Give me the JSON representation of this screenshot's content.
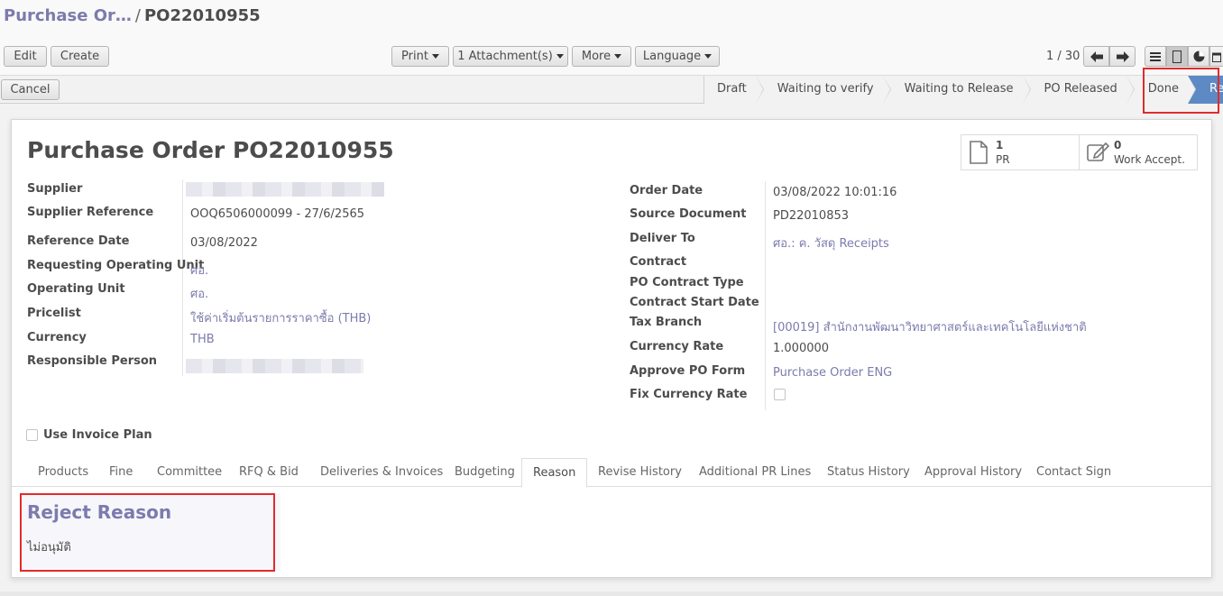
{
  "breadcrumb": {
    "parent": "Purchase Or…",
    "separator": "/",
    "current": "PO22010955"
  },
  "toolbar": {
    "edit_label": "Edit",
    "create_label": "Create",
    "print_label": "Print",
    "attachments_label": "1 Attachment(s)",
    "more_label": "More",
    "language_label": "Language",
    "cancel_label": "Cancel"
  },
  "pager": {
    "text": "1 / 30"
  },
  "stages": [
    "Draft",
    "Waiting to verify",
    "Waiting to Release",
    "PO Released",
    "Done",
    "Rejected"
  ],
  "active_stage": "Rejected",
  "form": {
    "title_prefix": "Purchase Order",
    "title_number": "PO22010955",
    "smart_buttons": [
      {
        "value": "1",
        "label": "PR",
        "icon": "document-icon"
      },
      {
        "value": "0",
        "label": "Work Accept.",
        "icon": "edit-icon"
      }
    ],
    "left_fields": {
      "supplier": {
        "label": "Supplier",
        "value": ""
      },
      "supplier_reference": {
        "label": "Supplier Reference",
        "value": "OOQ6506000099 - 27/6/2565"
      },
      "reference_date": {
        "label": "Reference Date",
        "value": "03/08/2022"
      },
      "requesting_operating_unit": {
        "label": "Requesting Operating Unit",
        "value": "ศอ."
      },
      "operating_unit": {
        "label": "Operating Unit",
        "value": "ศอ."
      },
      "pricelist": {
        "label": "Pricelist",
        "value": "ใช้ค่าเริ่มต้นรายการราคาซื้อ (THB)"
      },
      "currency": {
        "label": "Currency",
        "value": "THB"
      },
      "responsible_person": {
        "label": "Responsible Person",
        "value": ""
      }
    },
    "right_fields": {
      "order_date": {
        "label": "Order Date",
        "value": "03/08/2022 10:01:16"
      },
      "source_document": {
        "label": "Source Document",
        "value": "PD22010853"
      },
      "deliver_to": {
        "label": "Deliver To",
        "value": "ศอ.: ค. วัสดุ Receipts"
      },
      "contract": {
        "label": "Contract",
        "value": ""
      },
      "po_contract_type": {
        "label": "PO Contract Type",
        "value": ""
      },
      "contract_start_date": {
        "label": "Contract Start Date",
        "value": ""
      },
      "tax_branch": {
        "label": "Tax Branch",
        "value": "[00019] สำนักงานพัฒนาวิทยาศาสตร์และเทคโนโลยีแห่งชาติ"
      },
      "currency_rate": {
        "label": "Currency Rate",
        "value": "1.000000"
      },
      "approve_po_form": {
        "label": "Approve PO Form",
        "value": "Purchase Order ENG"
      },
      "fix_currency_rate": {
        "label": "Fix Currency Rate",
        "value": ""
      }
    },
    "use_invoice_plan_label": "Use Invoice Plan",
    "tabs": [
      "Products",
      "Fine",
      "Committee",
      "RFQ & Bid",
      "Deliveries & Invoices",
      "Budgeting",
      "Reason",
      "Revise History",
      "Additional PR Lines",
      "Status History",
      "Approval History",
      "Contact Sign"
    ],
    "active_tab": "Reason",
    "reject_reason": {
      "title": "Reject Reason",
      "text": "ไม่อนุมัติ"
    }
  },
  "colors": {
    "accent": "#7c7bad",
    "active_stage": "#5d8ac4",
    "highlight": "#e12b2b"
  }
}
